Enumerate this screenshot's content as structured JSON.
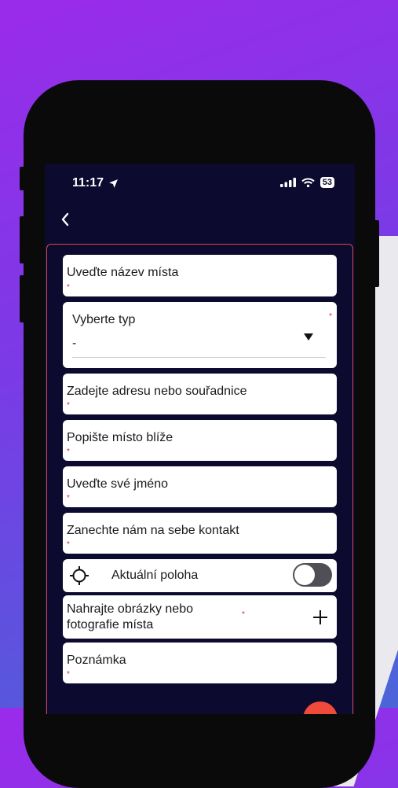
{
  "status_bar": {
    "time": "11:17",
    "battery": "53",
    "icons": [
      "location-arrow-icon",
      "signal-icon",
      "wifi-icon",
      "battery-icon"
    ]
  },
  "nav": {
    "back_icon": "chevron-left-icon"
  },
  "form": {
    "place_name": {
      "placeholder": "Uveďte název místa",
      "required_mark": "*"
    },
    "type_select": {
      "label": "Vyberte typ",
      "value": "-",
      "required_mark": "*"
    },
    "address": {
      "placeholder": "Zadejte adresu nebo souřadnice",
      "required_mark": "*"
    },
    "description": {
      "placeholder": "Popište místo blíže",
      "required_mark": "*"
    },
    "name": {
      "placeholder": "Uveďte své jméno",
      "required_mark": "*"
    },
    "contact": {
      "placeholder": "Zanechte nám na sebe kontakt",
      "required_mark": "*"
    },
    "location": {
      "label": "Aktuální poloha",
      "toggle_on": false
    },
    "photos": {
      "label": "Nahrajte obrázky nebo fotografie místa",
      "required_mark": "*"
    },
    "note": {
      "placeholder": "Poznámka",
      "required_mark": "*"
    }
  },
  "colors": {
    "background_top": "#9a2bea",
    "background_bottom": "#4a66d8",
    "screen": "#0c0a2e",
    "frame_border": "#d94a44",
    "required": "#e02a2a",
    "fab": "#f04a3a"
  }
}
